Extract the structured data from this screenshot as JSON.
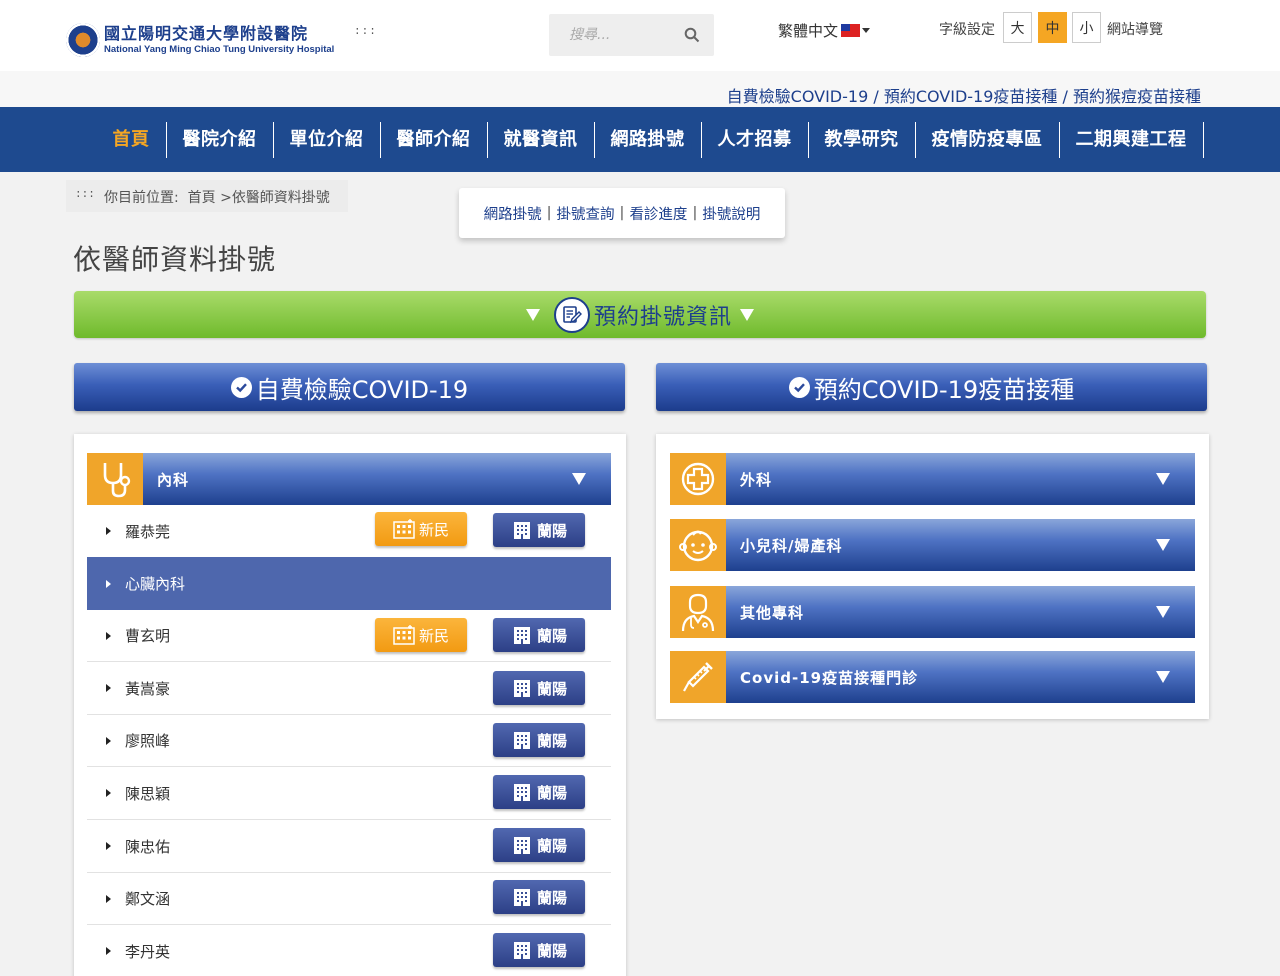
{
  "header": {
    "logo_cn": "國立陽明交通大學附設醫院",
    "logo_en": "National Yang Ming Chiao Tung University Hospital",
    "accesskey_top": ":::",
    "search_placeholder": "搜尋...",
    "language": "繁體中文",
    "font_size_label": "字級設定",
    "font_sizes": [
      "大",
      "中",
      "小"
    ],
    "font_size_active": "中",
    "sitemap": "網站導覽"
  },
  "announce": {
    "links": [
      "自費檢驗COVID-19",
      "預約COVID-19疫苗接種",
      "預約猴痘疫苗接種"
    ],
    "separator": " / "
  },
  "nav": {
    "items": [
      "首頁",
      "醫院介紹",
      "單位介紹",
      "醫師介紹",
      "就醫資訊",
      "網路掛號",
      "人才招募",
      "教學研究",
      "疫情防疫專區",
      "二期興建工程"
    ],
    "active": "首頁"
  },
  "breadcrumb": {
    "accesskey": ":::",
    "label": "你目前位置:",
    "home": "首頁",
    "separator": " >",
    "current": "依醫師資料掛號"
  },
  "submenu": {
    "items": [
      "網路掛號",
      "掛號查詢",
      "看診進度",
      "掛號說明"
    ],
    "separator": "|"
  },
  "page_title": "依醫師資料掛號",
  "green_banner": "預約掛號資訊",
  "blue_banners": {
    "left": "自費檢驗COVID-19",
    "right": "預約COVID-19疫苗接種"
  },
  "left_panel": {
    "dept": "內科",
    "sub_category": "心臟內科",
    "branches": {
      "xinmin": "新民",
      "lanyang": "蘭陽"
    },
    "doctors": [
      {
        "name": "羅恭莞",
        "xinmin": true
      },
      {
        "name": "曹玄明",
        "xinmin": true
      },
      {
        "name": "黃嵩豪",
        "xinmin": false
      },
      {
        "name": "廖照峰",
        "xinmin": false
      },
      {
        "name": "陳思穎",
        "xinmin": false
      },
      {
        "name": "陳忠佑",
        "xinmin": false
      },
      {
        "name": "鄭文涵",
        "xinmin": false
      },
      {
        "name": "李丹英",
        "xinmin": false
      }
    ]
  },
  "right_panel": {
    "depts": [
      {
        "name": "外科",
        "icon": "medical-cross-icon"
      },
      {
        "name": "小兒科/婦產科",
        "icon": "baby-icon"
      },
      {
        "name": "其他專科",
        "icon": "doctor-icon"
      },
      {
        "name": "Covid-19疫苗接種門診",
        "icon": "syringe-icon"
      }
    ]
  },
  "colors": {
    "nav_bg": "#1e4a8f",
    "accent_orange": "#f5a623",
    "link_blue": "#1d3f8c",
    "green": "#6fba2c"
  }
}
